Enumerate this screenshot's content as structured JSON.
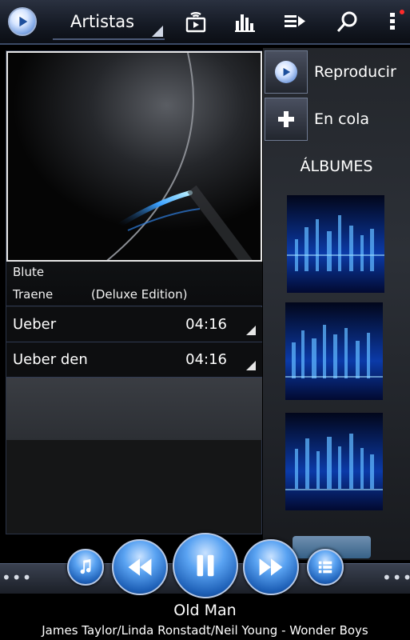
{
  "header": {
    "section_label": "Artistas",
    "icons": [
      "play-logo-icon",
      "cast-icon",
      "equalizer-icon",
      "queue-icon",
      "search-icon",
      "overflow-menu-icon"
    ]
  },
  "album": {
    "artist": "Blute",
    "title": "Traene",
    "edition": "(Deluxe Edition)"
  },
  "tracks": [
    {
      "title": "Ueber",
      "duration": "04:16"
    },
    {
      "title": "Ueber den",
      "duration": "04:16"
    }
  ],
  "actions": {
    "play_label": "Reproducir",
    "queue_label": "En cola"
  },
  "albums_heading": "ÁLBUMES",
  "now_playing": {
    "title": "Old Man",
    "subtitle": "James Taylor/Linda Ronstadt/Neil Young - Wonder Boys"
  },
  "colors": {
    "accent_blue": "#2f7fe0",
    "badge_red": "#ff2a2a"
  }
}
